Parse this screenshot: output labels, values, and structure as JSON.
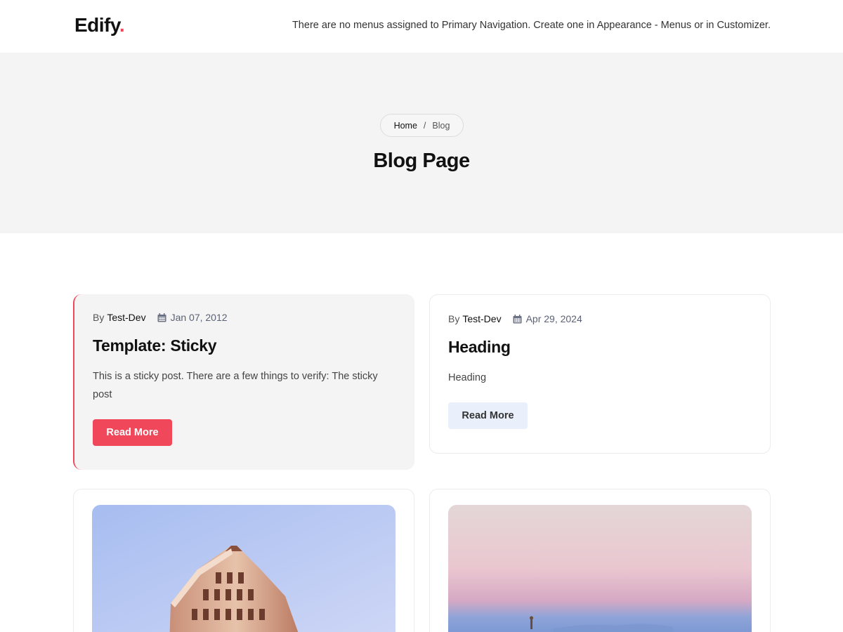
{
  "header": {
    "logo_text": "Edify",
    "logo_dot": ".",
    "nav_message": "There are no menus assigned to Primary Navigation. Create one in Appearance - Menus or in Customizer."
  },
  "hero": {
    "breadcrumb": {
      "home": "Home",
      "separator": "/",
      "current": "Blog"
    },
    "title": "Blog Page"
  },
  "posts": [
    {
      "by": "By",
      "author": "Test-Dev",
      "date": "Jan 07, 2012",
      "title": "Template: Sticky",
      "excerpt": "This is a sticky post. There are a few things to verify: The sticky post",
      "button": "Read More",
      "sticky": true
    },
    {
      "by": "By",
      "author": "Test-Dev",
      "date": "Apr 29, 2024",
      "title": "Heading",
      "excerpt": "Heading",
      "button": "Read More",
      "sticky": false
    }
  ],
  "colors": {
    "accent": "#f0485a",
    "hero_bg": "#f4f4f4",
    "light_button": "#eaf0fb"
  },
  "icons": {
    "date": "calendar-icon"
  }
}
